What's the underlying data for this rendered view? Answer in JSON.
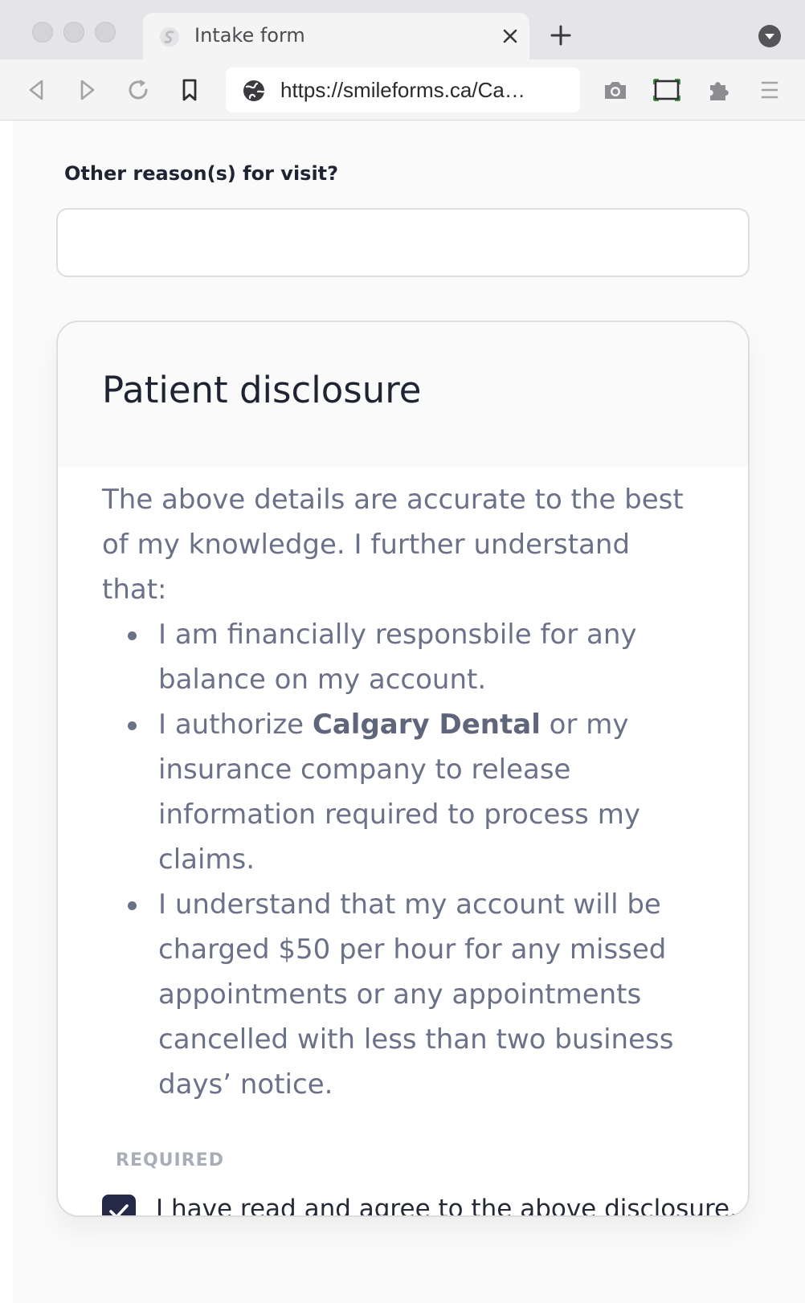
{
  "browser": {
    "tab_title": "Intake form",
    "url": "https://smileforms.ca/Ca…",
    "icons": [
      "back-icon",
      "forward-icon",
      "reload-icon",
      "bookmark-icon",
      "globe-icon",
      "camera-icon",
      "screen-icon",
      "extensions-icon",
      "menu-icon",
      "close-icon",
      "plus-icon",
      "chevron-down-icon"
    ]
  },
  "form": {
    "other_reason_label": "Other reason(s) for visit?",
    "other_reason_value": ""
  },
  "disclosure": {
    "title": "Patient disclosure",
    "intro": "The above details are accurate to the best of my knowledge. I further understand that:",
    "item1": "I am financially responsbile for any balance on my account.",
    "item2_prefix": "I authorize ",
    "item2_bold": "Calgary Dental",
    "item2_suffix": " or my insurance company to release information required to process my claims.",
    "item3": "I understand that my account will be charged $50 per hour for any missed appointments or any appointments cancelled with less than two business days’ notice.",
    "required_label": "REQUIRED",
    "agree_label": "I have read and agree to the above disclosure.",
    "agree_checked": true
  },
  "colors": {
    "checkbox": "#232946",
    "body_text": "#6b7187",
    "heading": "#1f2433"
  }
}
